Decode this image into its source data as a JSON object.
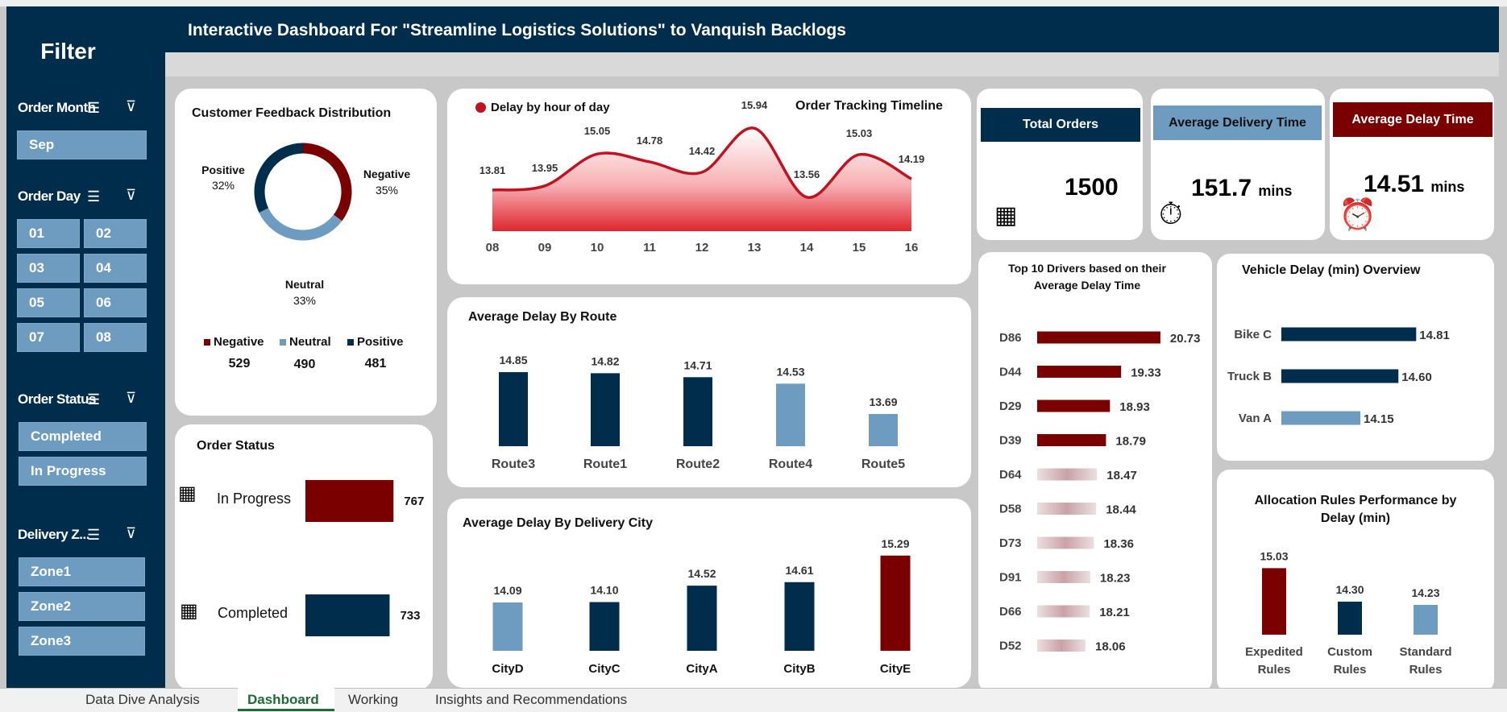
{
  "title": "Interactive Dashboard For \"Streamline Logistics Solutions\" to Vanquish Backlogs",
  "filter": {
    "title": "Filter",
    "slicers": [
      {
        "name": "Order Month",
        "items": [
          "Sep"
        ]
      },
      {
        "name": "Order Day",
        "items": [
          "01",
          "02",
          "03",
          "04",
          "05",
          "06",
          "07",
          "08"
        ]
      },
      {
        "name": "Order Status",
        "items": [
          "Completed",
          "In Progress"
        ]
      },
      {
        "name": "Delivery Z...",
        "items": [
          "Zone1",
          "Zone2",
          "Zone3"
        ]
      }
    ]
  },
  "feedback": {
    "title": "Customer Feedback Distribution",
    "labels": {
      "positive": "Positive",
      "negative": "Negative",
      "neutral": "Neutral"
    },
    "pcts": {
      "positive": "32%",
      "negative": "35%",
      "neutral": "33%"
    },
    "legend": [
      {
        "label": "Negative",
        "count": "529",
        "color": "#7a0000"
      },
      {
        "label": "Neutral",
        "count": "490",
        "color": "#6e9cc0"
      },
      {
        "label": "Positive",
        "count": "481",
        "color": "#002d4c"
      }
    ]
  },
  "order_status": {
    "title": "Order Status",
    "rows": [
      {
        "label": "In Progress",
        "value": "767"
      },
      {
        "label": "Completed",
        "value": "733"
      }
    ]
  },
  "timeline": {
    "legend": "Delay by hour of day",
    "title": "Order Tracking Timeline"
  },
  "route": {
    "title": "Average Delay By Route"
  },
  "city": {
    "title": "Average Delay By Delivery City"
  },
  "kpis": {
    "total": {
      "label": "Total Orders",
      "value": "1500"
    },
    "delivery": {
      "label": "Average Delivery Time",
      "value": "151.7",
      "unit": "mins"
    },
    "delay": {
      "label": "Average Delay Time",
      "value": "14.51",
      "unit": "mins"
    }
  },
  "drivers": {
    "title_l1": "Top 10 Drivers based on their",
    "title_l2": "Average Delay Time"
  },
  "vehicle": {
    "title": "Vehicle Delay (min) Overview"
  },
  "alloc": {
    "title_l1": "Allocation Rules Performance by",
    "title_l2": "Delay (min)"
  },
  "tabs": [
    "Data Dive Analysis",
    "Dashboard",
    "Working",
    "Insights and Recommendations"
  ],
  "colors": {
    "navy": "#002d4c",
    "maroon": "#7a0000",
    "lightblue": "#6e9cc0",
    "red": "#e0262e"
  },
  "chart_data": [
    {
      "id": "feedback",
      "type": "pie",
      "categories": [
        "Negative",
        "Neutral",
        "Positive"
      ],
      "values": [
        529,
        490,
        481
      ],
      "percent": [
        35,
        33,
        32
      ]
    },
    {
      "id": "status",
      "type": "bar",
      "categories": [
        "In Progress",
        "Completed"
      ],
      "values": [
        767,
        733
      ]
    },
    {
      "id": "timeline",
      "type": "area",
      "x": [
        "08",
        "09",
        "10",
        "11",
        "12",
        "13",
        "14",
        "15",
        "16"
      ],
      "series": [
        {
          "name": "Delay by hour of day",
          "values": [
            13.81,
            13.95,
            15.05,
            14.78,
            14.42,
            15.94,
            13.56,
            15.03,
            14.19
          ]
        }
      ]
    },
    {
      "id": "route",
      "type": "bar",
      "categories": [
        "Route3",
        "Route1",
        "Route2",
        "Route4",
        "Route5"
      ],
      "values": [
        14.85,
        14.82,
        14.71,
        14.53,
        13.69
      ]
    },
    {
      "id": "city",
      "type": "bar",
      "categories": [
        "CityD",
        "CityC",
        "CityA",
        "CityB",
        "CityE"
      ],
      "values": [
        14.09,
        14.1,
        14.52,
        14.61,
        15.29
      ]
    },
    {
      "id": "drivers",
      "type": "bar",
      "orientation": "horizontal",
      "categories": [
        "D86",
        "D44",
        "D29",
        "D39",
        "D64",
        "D58",
        "D73",
        "D91",
        "D66",
        "D52"
      ],
      "values": [
        20.73,
        19.33,
        18.93,
        18.79,
        18.47,
        18.44,
        18.36,
        18.23,
        18.21,
        18.06
      ]
    },
    {
      "id": "vehicle",
      "type": "bar",
      "orientation": "horizontal",
      "categories": [
        "Bike C",
        "Truck B",
        "Van A"
      ],
      "values": [
        14.81,
        14.6,
        14.15
      ]
    },
    {
      "id": "alloc",
      "type": "bar",
      "categories": [
        "Expedited Rules",
        "Custom Rules",
        "Standard Rules"
      ],
      "values": [
        15.03,
        14.3,
        14.23
      ]
    }
  ]
}
